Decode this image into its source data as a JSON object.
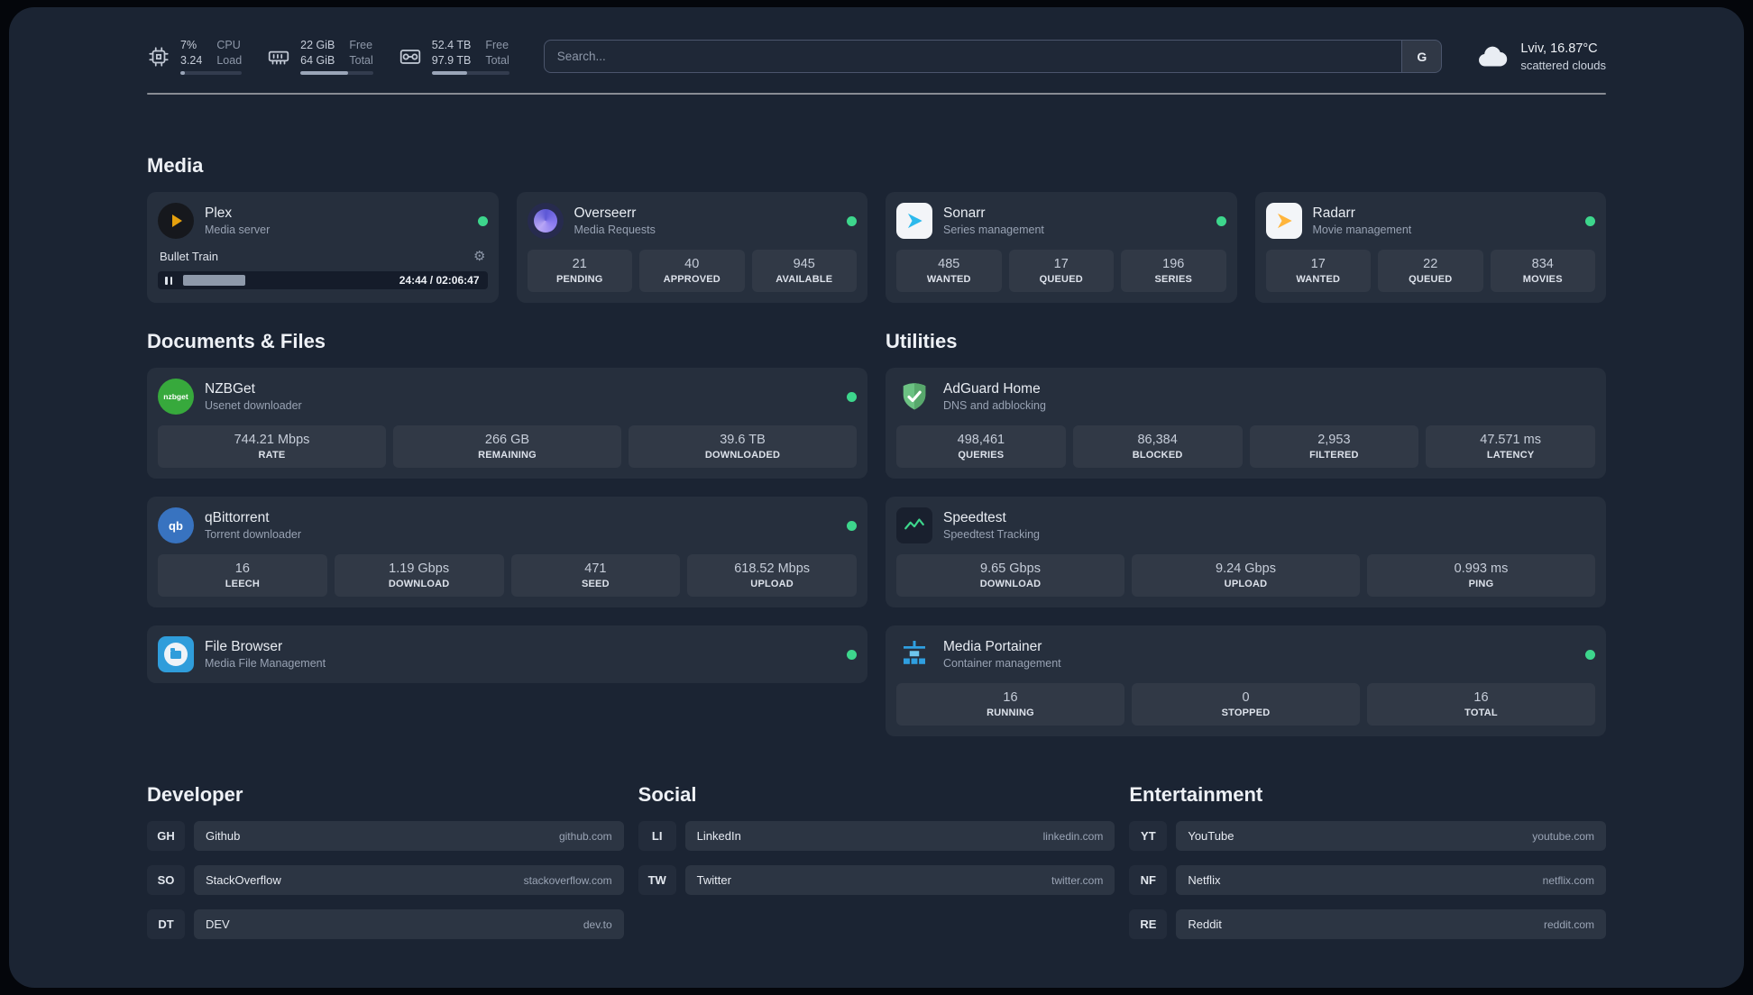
{
  "topbar": {
    "resources": [
      {
        "icon": "cpu-icon",
        "values": [
          "7%",
          "3.24"
        ],
        "labels": [
          "CPU",
          "Load"
        ],
        "progress_pct": 7
      },
      {
        "icon": "memory-icon",
        "values": [
          "22 GiB",
          "64 GiB"
        ],
        "labels": [
          "Free",
          "Total"
        ],
        "progress_pct": 66
      },
      {
        "icon": "disk-icon",
        "values": [
          "52.4 TB",
          "97.9 TB"
        ],
        "labels": [
          "Free",
          "Total"
        ],
        "progress_pct": 46
      }
    ],
    "search": {
      "placeholder": "Search...",
      "provider_label": "G"
    },
    "weather": {
      "icon": "cloud-icon",
      "location": "Lviv, 16.87°C",
      "condition": "scattered clouds"
    }
  },
  "sections": {
    "media": {
      "title": "Media",
      "cards": [
        {
          "icon": "plex-icon",
          "title": "Plex",
          "subtitle": "Media server",
          "status": "online",
          "player": {
            "track": "Bullet Train",
            "time": "24:44 / 02:06:47",
            "progress_pct": 19
          }
        },
        {
          "icon": "overseerr-icon",
          "title": "Overseerr",
          "subtitle": "Media Requests",
          "status": "online",
          "stats": [
            {
              "value": "21",
              "label": "PENDING"
            },
            {
              "value": "40",
              "label": "APPROVED"
            },
            {
              "value": "945",
              "label": "AVAILABLE"
            }
          ]
        },
        {
          "icon": "sonarr-icon",
          "title": "Sonarr",
          "subtitle": "Series management",
          "status": "online",
          "stats": [
            {
              "value": "485",
              "label": "WANTED"
            },
            {
              "value": "17",
              "label": "QUEUED"
            },
            {
              "value": "196",
              "label": "SERIES"
            }
          ]
        },
        {
          "icon": "radarr-icon",
          "title": "Radarr",
          "subtitle": "Movie management",
          "status": "online",
          "stats": [
            {
              "value": "17",
              "label": "WANTED"
            },
            {
              "value": "22",
              "label": "QUEUED"
            },
            {
              "value": "834",
              "label": "MOVIES"
            }
          ]
        }
      ]
    },
    "documents": {
      "title": "Documents & Files",
      "cards": [
        {
          "icon": "nzbget-icon",
          "icon_text": "nzbget",
          "title": "NZBGet",
          "subtitle": "Usenet downloader",
          "status": "online",
          "stats": [
            {
              "value": "744.21 Mbps",
              "label": "RATE"
            },
            {
              "value": "266 GB",
              "label": "REMAINING"
            },
            {
              "value": "39.6 TB",
              "label": "DOWNLOADED"
            }
          ]
        },
        {
          "icon": "qbittorrent-icon",
          "icon_text": "qb",
          "title": "qBittorrent",
          "subtitle": "Torrent downloader",
          "status": "online",
          "stats": [
            {
              "value": "16",
              "label": "LEECH"
            },
            {
              "value": "1.19 Gbps",
              "label": "DOWNLOAD"
            },
            {
              "value": "471",
              "label": "SEED"
            },
            {
              "value": "618.52 Mbps",
              "label": "UPLOAD"
            }
          ]
        },
        {
          "icon": "filebrowser-icon",
          "title": "File Browser",
          "subtitle": "Media File Management",
          "status": "online"
        }
      ]
    },
    "utilities": {
      "title": "Utilities",
      "cards": [
        {
          "icon": "adguard-icon",
          "title": "AdGuard Home",
          "subtitle": "DNS and adblocking",
          "stats": [
            {
              "value": "498,461",
              "label": "QUERIES"
            },
            {
              "value": "86,384",
              "label": "BLOCKED"
            },
            {
              "value": "2,953",
              "label": "FILTERED"
            },
            {
              "value": "47.571 ms",
              "label": "LATENCY"
            }
          ]
        },
        {
          "icon": "speedtest-icon",
          "title": "Speedtest",
          "subtitle": "Speedtest Tracking",
          "stats": [
            {
              "value": "9.65 Gbps",
              "label": "DOWNLOAD"
            },
            {
              "value": "9.24 Gbps",
              "label": "UPLOAD"
            },
            {
              "value": "0.993 ms",
              "label": "PING"
            }
          ]
        },
        {
          "icon": "portainer-icon",
          "title": "Media Portainer",
          "subtitle": "Container management",
          "status": "online",
          "stats": [
            {
              "value": "16",
              "label": "RUNNING"
            },
            {
              "value": "0",
              "label": "STOPPED"
            },
            {
              "value": "16",
              "label": "TOTAL"
            }
          ]
        }
      ]
    },
    "bookmarks": [
      {
        "title": "Developer",
        "items": [
          {
            "abbr": "GH",
            "name": "Github",
            "domain": "github.com"
          },
          {
            "abbr": "SO",
            "name": "StackOverflow",
            "domain": "stackoverflow.com"
          },
          {
            "abbr": "DT",
            "name": "DEV",
            "domain": "dev.to"
          }
        ]
      },
      {
        "title": "Social",
        "items": [
          {
            "abbr": "LI",
            "name": "LinkedIn",
            "domain": "linkedin.com"
          },
          {
            "abbr": "TW",
            "name": "Twitter",
            "domain": "twitter.com"
          }
        ]
      },
      {
        "title": "Entertainment",
        "items": [
          {
            "abbr": "YT",
            "name": "YouTube",
            "domain": "youtube.com"
          },
          {
            "abbr": "NF",
            "name": "Netflix",
            "domain": "netflix.com"
          },
          {
            "abbr": "RE",
            "name": "Reddit",
            "domain": "reddit.com"
          }
        ]
      }
    ]
  },
  "colors": {
    "status_online": "#3dd68c",
    "background": "#1b2433",
    "accent_plex": "#e5a00d"
  }
}
